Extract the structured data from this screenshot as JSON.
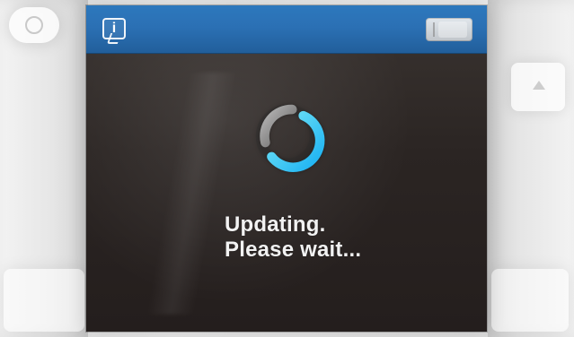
{
  "icons": {
    "info": "info-bubble-icon",
    "ink": "ink-level-icon",
    "spinner": "loading-spinner-icon",
    "hw_left_top": "power-icon",
    "hw_right_up": "up-arrow-icon"
  },
  "statusbar": {
    "info_symbol": "i"
  },
  "loading": {
    "line1": "Updating.",
    "line2": "Please wait..."
  },
  "colors": {
    "topbar_blue": "#2b70b4",
    "spinner_cyan": "#2dd4ff",
    "text": "#f2f2f2"
  }
}
